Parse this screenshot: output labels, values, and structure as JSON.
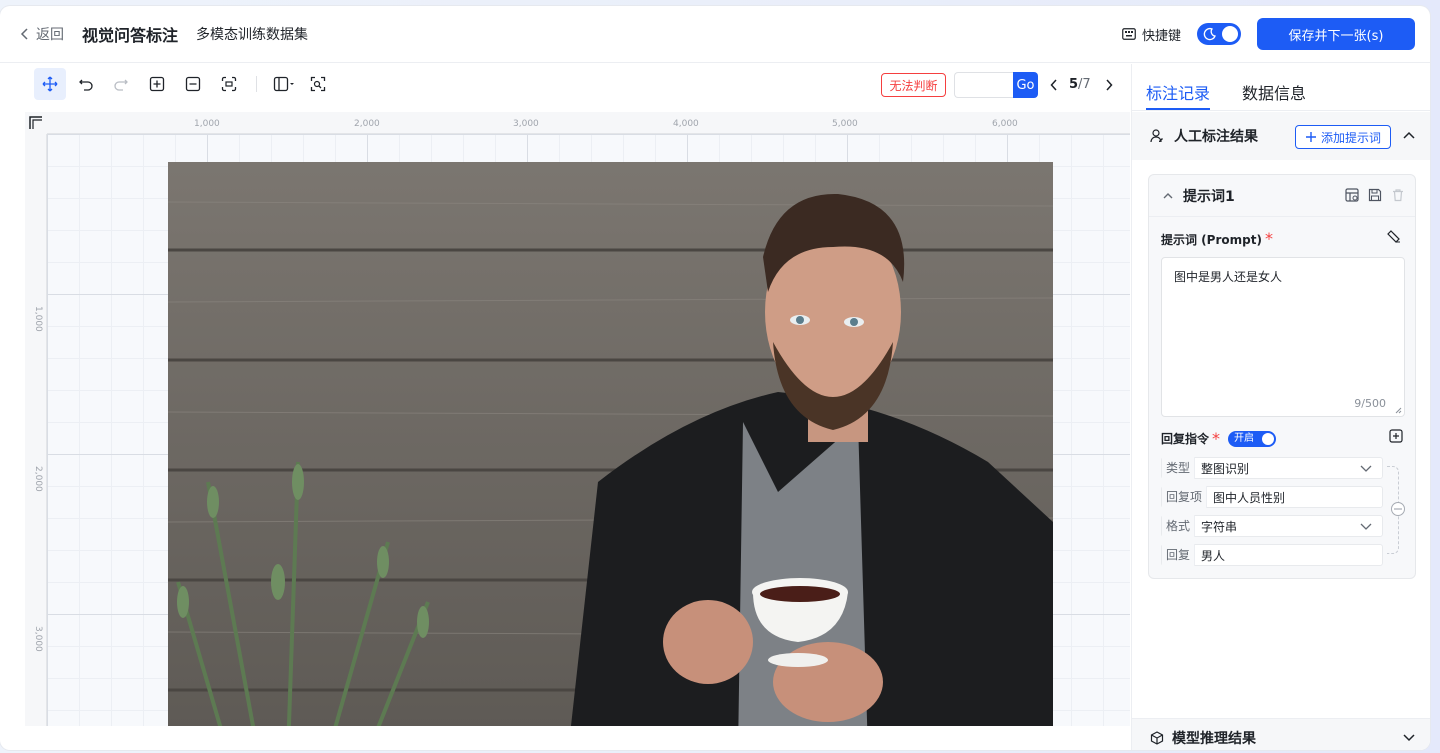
{
  "header": {
    "back_label": "返回",
    "title": "视觉问答标注",
    "dataset": "多模态训练数据集",
    "shortcut_label": "快捷键",
    "save_label": "保存并下一张(s)"
  },
  "toolbar": {
    "tools": [
      "move-icon",
      "undo-icon",
      "redo-icon",
      "zoom-in-icon",
      "zoom-out-icon",
      "fit-screen-icon",
      "layout-icon",
      "ai-detect-icon"
    ],
    "cannot_judge_label": "无法判断",
    "go_label": "Go",
    "page_current": "5",
    "page_total": "/7"
  },
  "canvas": {
    "ruler_top_labels": [
      "1,000",
      "2,000",
      "3,000",
      "4,000",
      "5,000",
      "6,000"
    ],
    "ruler_left_labels": [
      "1,000",
      "2,000",
      "3,000"
    ]
  },
  "panel": {
    "tab_records": "标注记录",
    "tab_data_info": "数据信息",
    "manual_result_title": "人工标注结果",
    "add_prompt_label": "添加提示词",
    "prompt_card_title": "提示词1",
    "prompt_label": "提示词 (Prompt)",
    "required_mark": "*",
    "prompt_text": "图中是男人还是女人",
    "prompt_counter": "9/500",
    "reply_label": "回复指令",
    "reply_switch": "开启",
    "fields": [
      {
        "key": "类型",
        "value": "整图识别"
      },
      {
        "key": "回复项",
        "value": "图中人员性别"
      },
      {
        "key": "格式",
        "value": "字符串"
      },
      {
        "key": "回复",
        "value": "男人"
      }
    ],
    "model_result_title": "模型推理结果"
  },
  "colors": {
    "primary": "#1d5cf5",
    "danger": "#f53f3f"
  }
}
